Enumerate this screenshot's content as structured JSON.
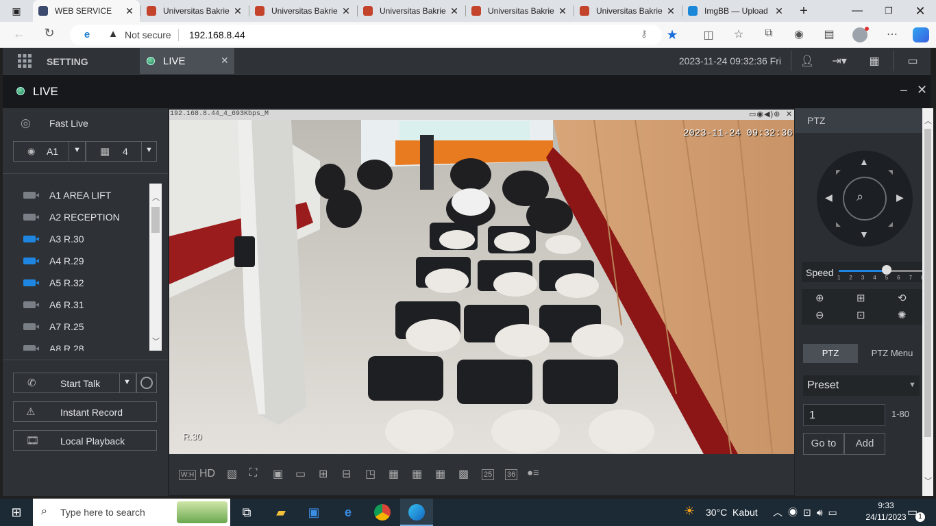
{
  "browser": {
    "tabs": [
      {
        "title": "WEB SERVICE",
        "active": true,
        "favicon_color": "#3c4a6e"
      },
      {
        "title": "Universitas Bakrie",
        "active": false,
        "favicon_color": "#c4432b"
      },
      {
        "title": "Universitas Bakrie",
        "active": false,
        "favicon_color": "#c4432b"
      },
      {
        "title": "Universitas Bakrie",
        "active": false,
        "favicon_color": "#c4432b"
      },
      {
        "title": "Universitas Bakrie",
        "active": false,
        "favicon_color": "#c4432b"
      },
      {
        "title": "Universitas Bakrie",
        "active": false,
        "favicon_color": "#c4432b"
      },
      {
        "title": "ImgBB — Upload",
        "active": false,
        "favicon_color": "#1a87d8"
      }
    ],
    "new_tab": "+",
    "security_label": "Not secure",
    "url": "192.168.8.44"
  },
  "app": {
    "setting_label": "SETTING",
    "live_tab_label": "LIVE",
    "datetime": "2023-11-24 09:32:36 Fri",
    "live_title": "LIVE"
  },
  "left_panel": {
    "fast_live_label": "Fast Live",
    "area_select": "A1",
    "layout_select": "4",
    "cameras": [
      {
        "label": "A1 AREA LIFT",
        "online": false
      },
      {
        "label": "A2 RECEPTION",
        "online": false
      },
      {
        "label": "A3 R.30",
        "online": true
      },
      {
        "label": "A4 R.29",
        "online": true
      },
      {
        "label": "A5 R.32",
        "online": true
      },
      {
        "label": "A6 R.31",
        "online": false
      },
      {
        "label": "A7 R.25",
        "online": false
      },
      {
        "label": "A8 R.28",
        "online": false
      }
    ],
    "start_talk_label": "Start Talk",
    "instant_record_label": "Instant Record",
    "local_playback_label": "Local Playback"
  },
  "video": {
    "stream_info": "192.168.8.44_4_693Kbps_M",
    "osd_timestamp": "2023-11-24 09:32:36",
    "osd_room": "R.30",
    "toolbar_labels": [
      "W:H",
      "HD",
      "25",
      "36"
    ]
  },
  "ptz": {
    "title": "PTZ",
    "speed_label": "Speed",
    "speed_value": 5,
    "speed_ticks": [
      "1",
      "2",
      "3",
      "4",
      "5",
      "6",
      "7",
      "8"
    ],
    "tab_ptz": "PTZ",
    "tab_ptz_menu": "PTZ Menu",
    "preset_label": "Preset",
    "preset_value": "1",
    "preset_range": "1-80",
    "goto_label": "Go to",
    "add_label": "Add"
  },
  "taskbar": {
    "search_placeholder": "Type here to search",
    "weather": "30°C  Kabut",
    "time": "9:33",
    "date": "24/11/2023",
    "notification_count": "1"
  }
}
